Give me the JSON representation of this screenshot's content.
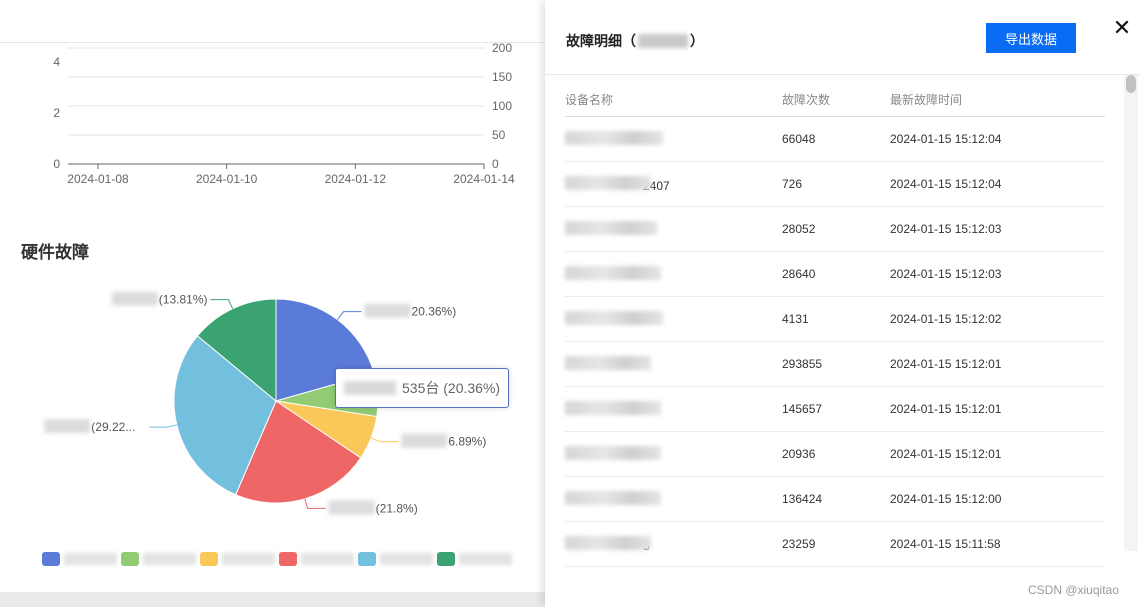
{
  "line_chart": {
    "type": "line",
    "x_ticks": [
      "2024-01-08",
      "2024-01-10",
      "2024-01-12",
      "2024-01-14"
    ],
    "y_left_ticks": [
      "0",
      "2",
      "4"
    ],
    "y_right_ticks": [
      "0",
      "50",
      "100",
      "150",
      "200"
    ],
    "ylim_left": [
      0,
      4
    ],
    "ylim_right": [
      0,
      200
    ],
    "grid": true
  },
  "section": {
    "title": "硬件故障"
  },
  "chart_data": {
    "type": "pie",
    "slices": [
      {
        "label_suffix": "20.36%)",
        "value": 20.36,
        "color": "#5b7bd8"
      },
      {
        "label_suffix": "",
        "value": 6.76,
        "color": "#91cc75"
      },
      {
        "label_suffix": "6.89%)",
        "value": 6.89,
        "color": "#fac858"
      },
      {
        "label_suffix": "(21.8%)",
        "value": 21.8,
        "color": "#ee6666"
      },
      {
        "label_suffix": "(29.22...",
        "value": 29.22,
        "color": "#73c0de"
      },
      {
        "label_suffix": "(13.81%)",
        "value": 13.81,
        "color": "#3ba272"
      }
    ],
    "tooltip": "535台 (20.36%)"
  },
  "legend": {
    "colors": [
      "#5b7bd8",
      "#91cc75",
      "#fac858",
      "#ee6666",
      "#73c0de",
      "#3ba272"
    ]
  },
  "drawer": {
    "title_prefix": "故障明细（",
    "title_suffix": "）",
    "export_label": "导出数据",
    "close_label": "✕",
    "columns": [
      "设备名称",
      "故障次数",
      "最新故障时间"
    ],
    "rows": [
      {
        "name_tail": "",
        "count": "66048",
        "time": "2024-01-15 15:12:04"
      },
      {
        "name_tail": "2407",
        "count": "726",
        "time": "2024-01-15 15:12:04"
      },
      {
        "name_tail": "",
        "count": "28052",
        "time": "2024-01-15 15:12:03"
      },
      {
        "name_tail": "",
        "count": "28640",
        "time": "2024-01-15 15:12:03"
      },
      {
        "name_tail": "",
        "count": "4131",
        "time": "2024-01-15 15:12:02"
      },
      {
        "name_tail": "",
        "count": "293855",
        "time": "2024-01-15 15:12:01"
      },
      {
        "name_tail": "",
        "count": "145657",
        "time": "2024-01-15 15:12:01"
      },
      {
        "name_tail": "",
        "count": "20936",
        "time": "2024-01-15 15:12:01"
      },
      {
        "name_tail": "",
        "count": "136424",
        "time": "2024-01-15 15:12:00"
      },
      {
        "name_tail": "5",
        "count": "23259",
        "time": "2024-01-15 15:11:58"
      }
    ]
  },
  "watermark": "CSDN @xiuqitao"
}
